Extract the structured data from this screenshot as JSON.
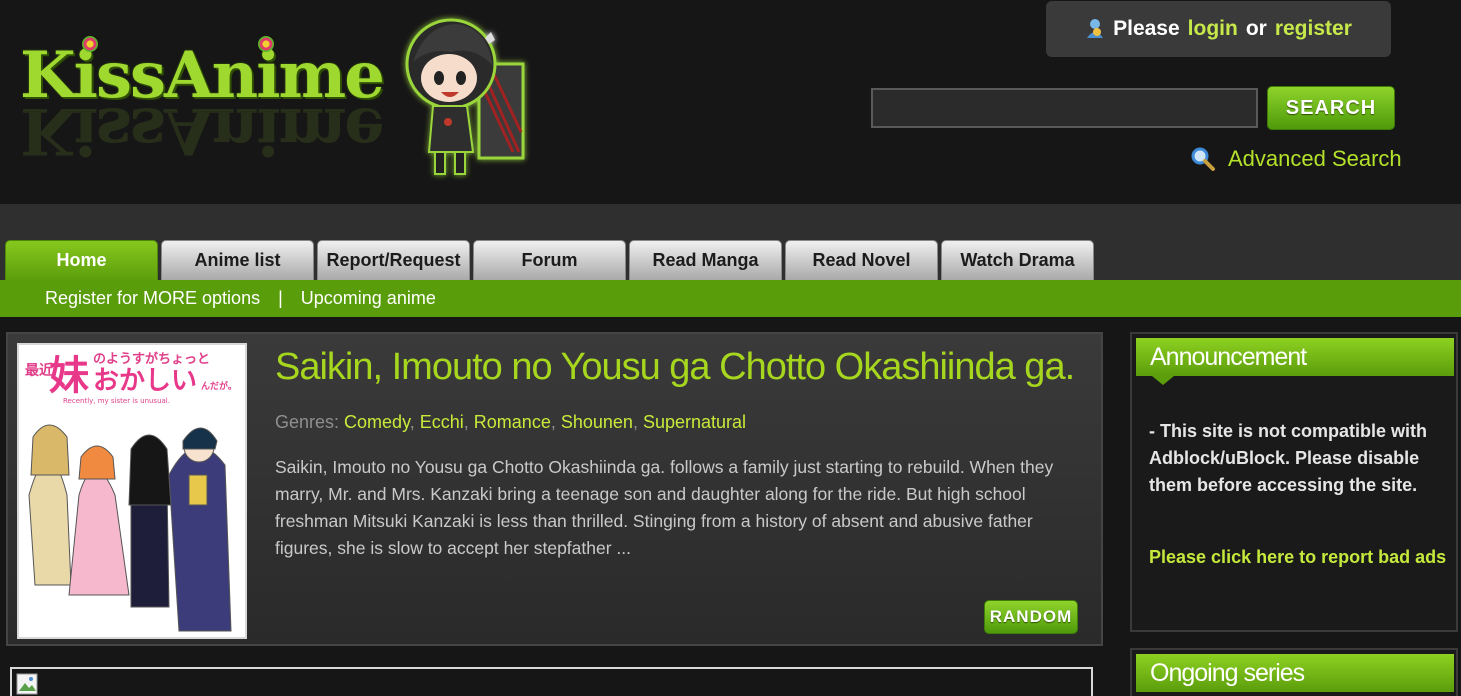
{
  "header": {
    "logo_text": "KissAnime",
    "login": {
      "prefix": "Please",
      "login_label": "login",
      "or_text": "or",
      "register_label": "register"
    },
    "search": {
      "value": "",
      "button_label": "SEARCH",
      "advanced_label": "Advanced Search"
    }
  },
  "nav": {
    "tabs": [
      {
        "label": "Home",
        "active": true
      },
      {
        "label": "Anime list"
      },
      {
        "label": "Report/Request"
      },
      {
        "label": "Forum"
      },
      {
        "label": "Read Manga"
      },
      {
        "label": "Read Novel"
      },
      {
        "label": "Watch Drama"
      }
    ],
    "subnav": {
      "register_label": "Register for MORE options",
      "separator": "|",
      "upcoming_label": "Upcoming anime"
    }
  },
  "featured": {
    "title": "Saikin, Imouto no Yousu ga Chotto Okashiinda ga.",
    "genres_label": "Genres:",
    "genres": [
      "Comedy",
      "Ecchi",
      "Romance",
      "Shounen",
      "Supernatural"
    ],
    "description": "Saikin, Imouto no Yousu ga Chotto Okashiinda ga. follows a family just starting to rebuild. When they marry, Mr. and Mrs. Kanzaki bring a teenage son and daughter along for the ride. But high school freshman Mitsuki Kanzaki is less than thrilled. Stinging from a history of absent and abusive father figures, she is slow to accept her stepfather ...",
    "random_label": "RANDOM",
    "poster": {
      "title_jp_small": "最近",
      "title_jp_big": "妹",
      "title_jp_hira": "のようすがちょっと",
      "title_jp_hira2": "おかしい",
      "title_jp_tail": "んだが。",
      "subtitle_en": "Recently, my sister is unusual."
    }
  },
  "sidebar": {
    "announcement": {
      "heading": "Announcement",
      "text": "- This site is not compatible with Adblock/uBlock. Please disable them before accessing the site.",
      "link": "Please click here to report bad ads"
    },
    "ongoing": {
      "heading": "Ongoing series"
    }
  },
  "colors": {
    "accent_green": "#5a9d0a",
    "link_green": "#c6e84a",
    "title_green": "#a6d61e",
    "background": "#161616"
  }
}
